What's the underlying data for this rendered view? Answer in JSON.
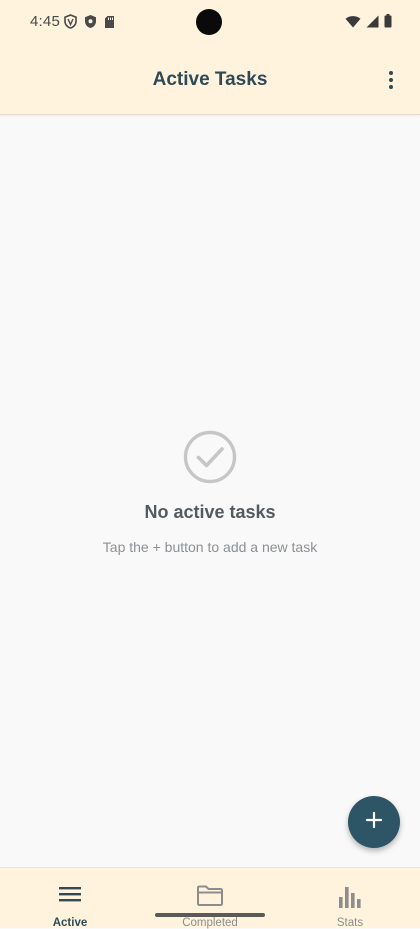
{
  "status_bar": {
    "time": "4:45",
    "left_icons": [
      "vpn-shield-icon",
      "shield-icon",
      "sd-card-icon"
    ],
    "right_icons": [
      "wifi-icon",
      "cell-signal-icon",
      "battery-icon"
    ]
  },
  "app_bar": {
    "title": "Active Tasks",
    "menu_icon": "more-vert-icon",
    "background": "#fff3dd",
    "title_color": "#2e4a57"
  },
  "empty_state": {
    "icon": "check-circle-icon",
    "title": "No active tasks",
    "subtitle": "Tap the + button to add a new task"
  },
  "fab": {
    "icon": "add-icon",
    "color": "#2e5566"
  },
  "bottom_nav": {
    "items": [
      {
        "label": "Active",
        "icon": "list-icon",
        "selected": true
      },
      {
        "label": "Completed",
        "icon": "folder-icon",
        "selected": false
      },
      {
        "label": "Stats",
        "icon": "bar-chart-icon",
        "selected": false
      }
    ]
  }
}
